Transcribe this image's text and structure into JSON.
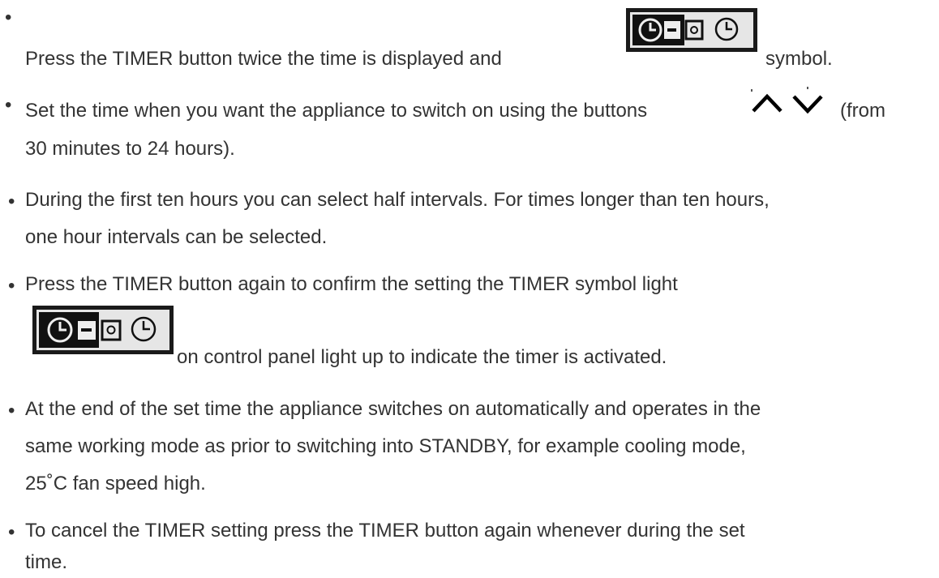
{
  "bullet": "•",
  "items": [
    {
      "line1_before": "Press the TIMER button twice the time is displayed and",
      "line1_after": "symbol."
    },
    {
      "line1_before": "Set the time when you want the appliance to switch on using the buttons",
      "line1_after": "(from",
      "line2": "30 minutes to 24 hours)."
    },
    {
      "line1": "During the first ten hours you can select half intervals. For times longer than ten hours,",
      "line2": "one hour intervals can be selected."
    },
    {
      "line1": "Press the TIMER button again to confirm the setting the TIMER symbol light",
      "line2": "on control panel light up to indicate the timer is activated."
    },
    {
      "line1": "At the end of the set time the appliance switches on automatically and operates in the",
      "line2": "same working mode as prior to switching into STANDBY, for example cooling mode,",
      "line3": "25˚C fan speed high."
    },
    {
      "line1": "To cancel the TIMER setting press the TIMER button again whenever during the set",
      "line2": "time."
    }
  ],
  "icons": {
    "timer_panel": "timer-panel-icon",
    "arrows": "up-down-arrows-icon"
  }
}
